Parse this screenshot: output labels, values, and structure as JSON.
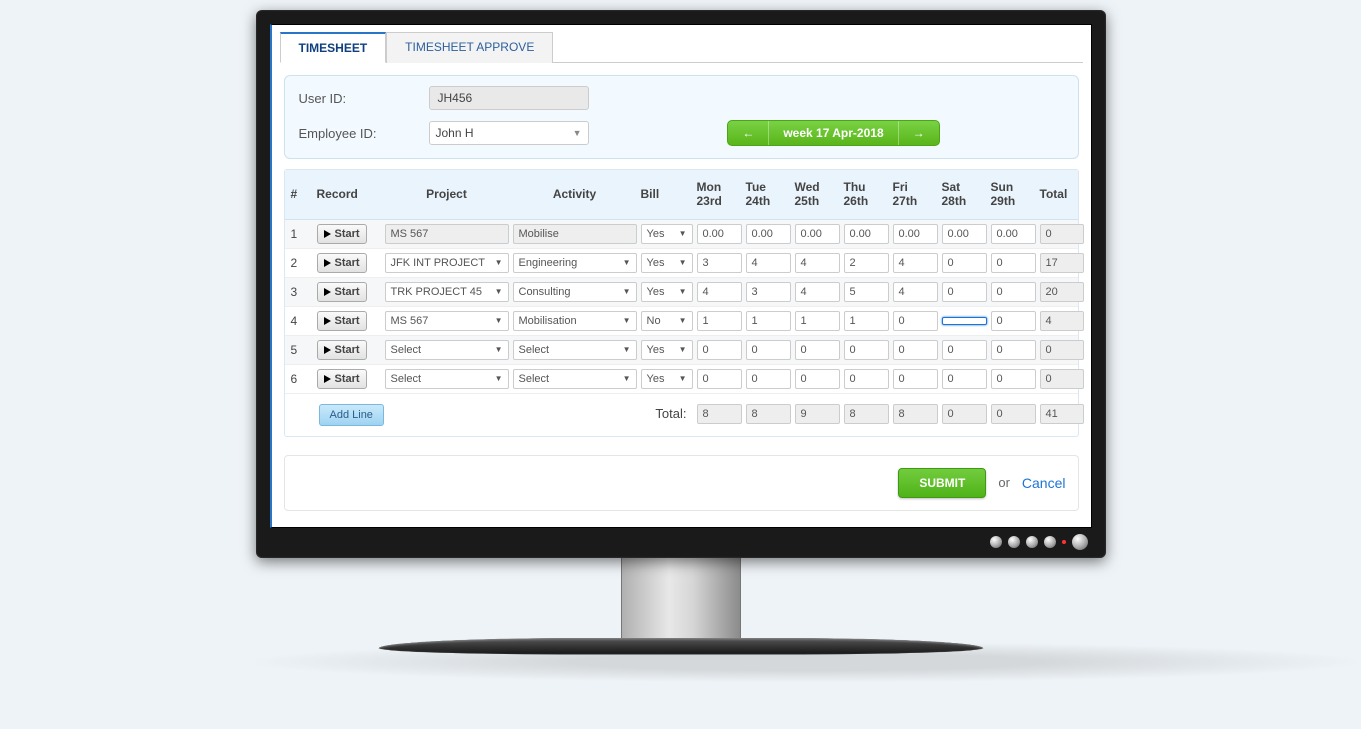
{
  "tabs": [
    {
      "label": "TIMESHEET",
      "active": true
    },
    {
      "label": "TIMESHEET APPROVE",
      "active": false
    }
  ],
  "header": {
    "userIdLabel": "User ID:",
    "userId": "JH456",
    "employeeIdLabel": "Employee ID:",
    "employeeId": "John H",
    "weekLabel": "week 17 Apr-2018"
  },
  "columns": {
    "num": "#",
    "record": "Record",
    "project": "Project",
    "activity": "Activity",
    "bill": "Bill",
    "days": [
      {
        "d": "Mon",
        "n": "23rd"
      },
      {
        "d": "Tue",
        "n": "24th"
      },
      {
        "d": "Wed",
        "n": "25th"
      },
      {
        "d": "Thu",
        "n": "26th"
      },
      {
        "d": "Fri",
        "n": "27th"
      },
      {
        "d": "Sat",
        "n": "28th"
      },
      {
        "d": "Sun",
        "n": "29th"
      }
    ],
    "total": "Total"
  },
  "recordButton": "Start",
  "rows": [
    {
      "num": 1,
      "project": "MS 567",
      "projectRO": true,
      "activity": "Mobilise",
      "activityRO": true,
      "bill": "Yes",
      "hours": [
        "0.00",
        "0.00",
        "0.00",
        "0.00",
        "0.00",
        "0.00",
        "0.00"
      ],
      "total": "0"
    },
    {
      "num": 2,
      "project": "JFK INT PROJECT",
      "projectRO": false,
      "activity": "Engineering",
      "activityRO": false,
      "bill": "Yes",
      "hours": [
        "3",
        "4",
        "4",
        "2",
        "4",
        "0",
        "0"
      ],
      "total": "17"
    },
    {
      "num": 3,
      "project": "TRK PROJECT 45",
      "projectRO": false,
      "activity": "Consulting",
      "activityRO": false,
      "bill": "Yes",
      "hours": [
        "4",
        "3",
        "4",
        "5",
        "4",
        "0",
        "0"
      ],
      "total": "20"
    },
    {
      "num": 4,
      "project": "MS 567",
      "projectRO": false,
      "activity": "Mobilisation",
      "activityRO": false,
      "bill": "No",
      "hours": [
        "1",
        "1",
        "1",
        "1",
        "0",
        "",
        "0"
      ],
      "total": "4",
      "highlight": 5
    },
    {
      "num": 5,
      "project": "Select",
      "projectRO": false,
      "activity": "Select",
      "activityRO": false,
      "bill": "Yes",
      "hours": [
        "0",
        "0",
        "0",
        "0",
        "0",
        "0",
        "0"
      ],
      "total": "0"
    },
    {
      "num": 6,
      "project": "Select",
      "projectRO": false,
      "activity": "Select",
      "activityRO": false,
      "bill": "Yes",
      "hours": [
        "0",
        "0",
        "0",
        "0",
        "0",
        "0",
        "0"
      ],
      "total": "0"
    }
  ],
  "totals": {
    "label": "Total:",
    "days": [
      "8",
      "8",
      "9",
      "8",
      "8",
      "0",
      "0"
    ],
    "grand": "41"
  },
  "addLine": "Add Line",
  "footer": {
    "submit": "SUBMIT",
    "or": "or",
    "cancel": "Cancel"
  }
}
